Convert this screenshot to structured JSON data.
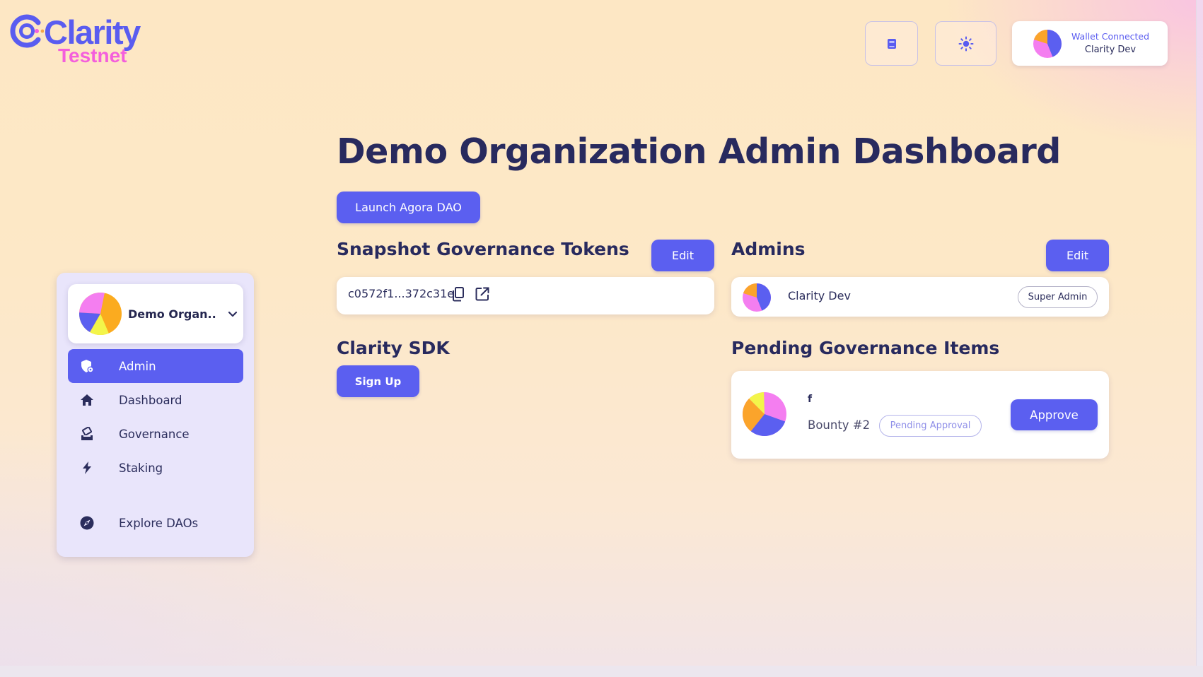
{
  "brand": {
    "name": "Clarity",
    "network": "Testnet",
    "primary_color": "#5b5ff0",
    "accent_color": "#f45fdc"
  },
  "header": {
    "docs_icon": "book-icon",
    "theme_icon": "sun-icon",
    "wallet": {
      "status": "Wallet Connected",
      "name": "Clarity Dev"
    }
  },
  "sidebar": {
    "org_name": "Demo Organ...",
    "items": [
      {
        "label": "Admin",
        "icon": "admin-shield-icon",
        "active": true
      },
      {
        "label": "Dashboard",
        "icon": "home-icon",
        "active": false
      },
      {
        "label": "Governance",
        "icon": "ballot-icon",
        "active": false
      },
      {
        "label": "Staking",
        "icon": "lightning-icon",
        "active": false
      },
      {
        "label": "Explore DAOs",
        "icon": "compass-icon",
        "active": false
      }
    ]
  },
  "main": {
    "title": "Demo Organization Admin Dashboard",
    "launch_button": "Launch Agora DAO",
    "snapshot": {
      "title": "Snapshot Governance Tokens",
      "edit_label": "Edit",
      "token": "c0572f1...372c31e"
    },
    "admins": {
      "title": "Admins",
      "edit_label": "Edit",
      "items": [
        {
          "name": "Clarity Dev",
          "role": "Super Admin"
        }
      ]
    },
    "sdk": {
      "title": "Clarity SDK",
      "signup_label": "Sign Up"
    },
    "pending": {
      "title": "Pending Governance Items",
      "items": [
        {
          "title": "f",
          "name": "Bounty #2",
          "status": "Pending Approval",
          "action": "Approve"
        }
      ]
    }
  }
}
